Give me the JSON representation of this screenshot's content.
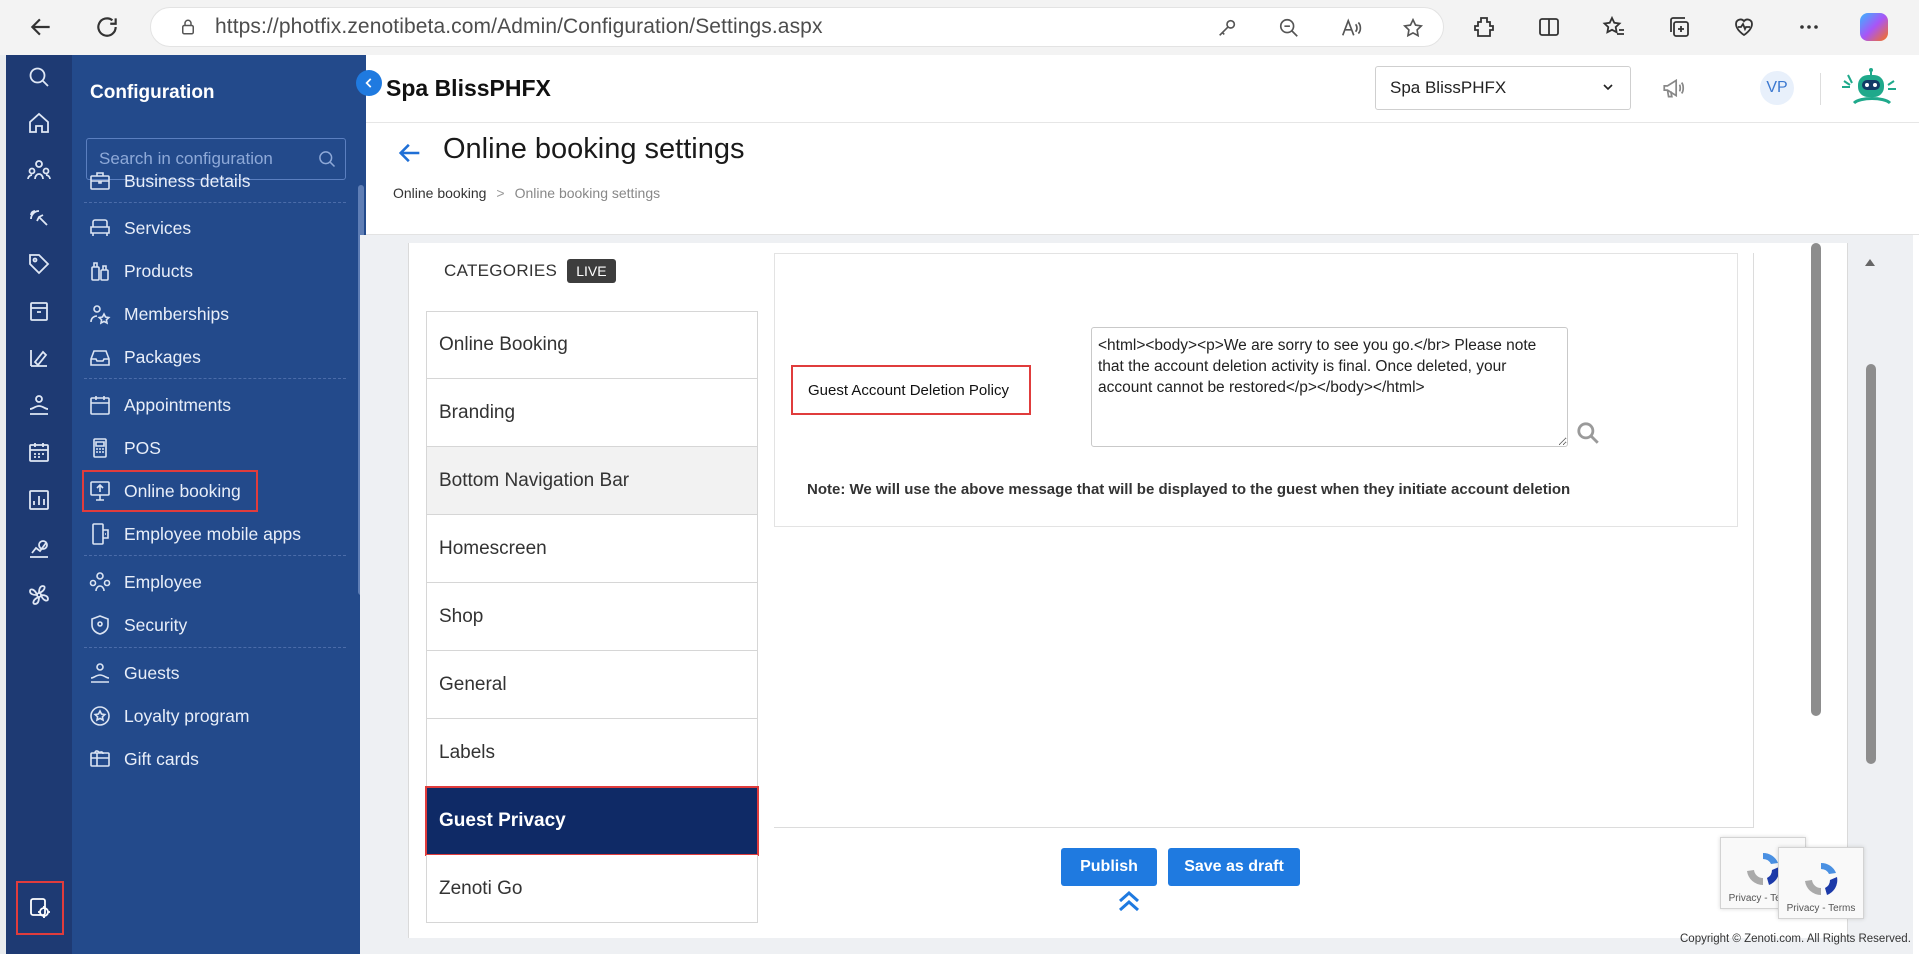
{
  "browser": {
    "url": "https://photfix.zenotibeta.com/Admin/Configuration/Settings.aspx"
  },
  "sidebar": {
    "title": "Configuration",
    "search_placeholder": "Search in configuration",
    "items": [
      {
        "label": "Business details",
        "icon": "briefcase-icon"
      },
      {
        "label": "Services",
        "icon": "armchair-icon"
      },
      {
        "label": "Products",
        "icon": "bottles-icon"
      },
      {
        "label": "Memberships",
        "icon": "member-star-icon"
      },
      {
        "label": "Packages",
        "icon": "package-tray-icon"
      },
      {
        "label": "Appointments",
        "icon": "calendar-icon"
      },
      {
        "label": "POS",
        "icon": "pos-terminal-icon"
      },
      {
        "label": "Online booking",
        "icon": "monitor-upload-icon"
      },
      {
        "label": "Employee mobile apps",
        "icon": "mobile-app-icon"
      },
      {
        "label": "Employee",
        "icon": "team-icon"
      },
      {
        "label": "Security",
        "icon": "shield-icon"
      },
      {
        "label": "Guests",
        "icon": "guest-hand-icon"
      },
      {
        "label": "Loyalty program",
        "icon": "loyalty-star-icon"
      },
      {
        "label": "Gift cards",
        "icon": "gift-card-icon"
      }
    ]
  },
  "topbar": {
    "org_name": "Spa BlissPHFX",
    "org_select_value": "Spa BlissPHFX",
    "avatar_initials": "VP"
  },
  "header": {
    "title": "Online booking settings",
    "breadcrumb": [
      "Online booking",
      "Online booking settings"
    ],
    "breadcrumb_sep": ">"
  },
  "categories": {
    "label": "CATEGORIES",
    "badge": "LIVE",
    "items": [
      "Online Booking",
      "Branding",
      "Bottom Navigation Bar",
      "Homescreen",
      "Shop",
      "General",
      "Labels",
      "Guest Privacy",
      "Zenoti Go"
    ],
    "selected": "Guest Privacy"
  },
  "settings": {
    "policy_label": "Guest Account Deletion Policy",
    "policy_value": "<html><body><p>We are sorry to see you go.</br> Please note that the account deletion activity is final. Once deleted, your account cannot be restored</p></body></html>",
    "note": "Note: We will use the above message that will be displayed to the guest when they initiate account deletion"
  },
  "actions": {
    "publish": "Publish",
    "save_draft": "Save as draft"
  },
  "recaptcha": {
    "text": "Privacy - Terms"
  },
  "footer": {
    "copyright": "Copyright © Zenoti.com. All Rights Reserved."
  },
  "colors": {
    "rail": "#1e3a73",
    "sidebar": "#234a8b",
    "accent": "#1f7ae0",
    "selected_category": "#0f2a66",
    "highlight": "#e03c3c"
  }
}
